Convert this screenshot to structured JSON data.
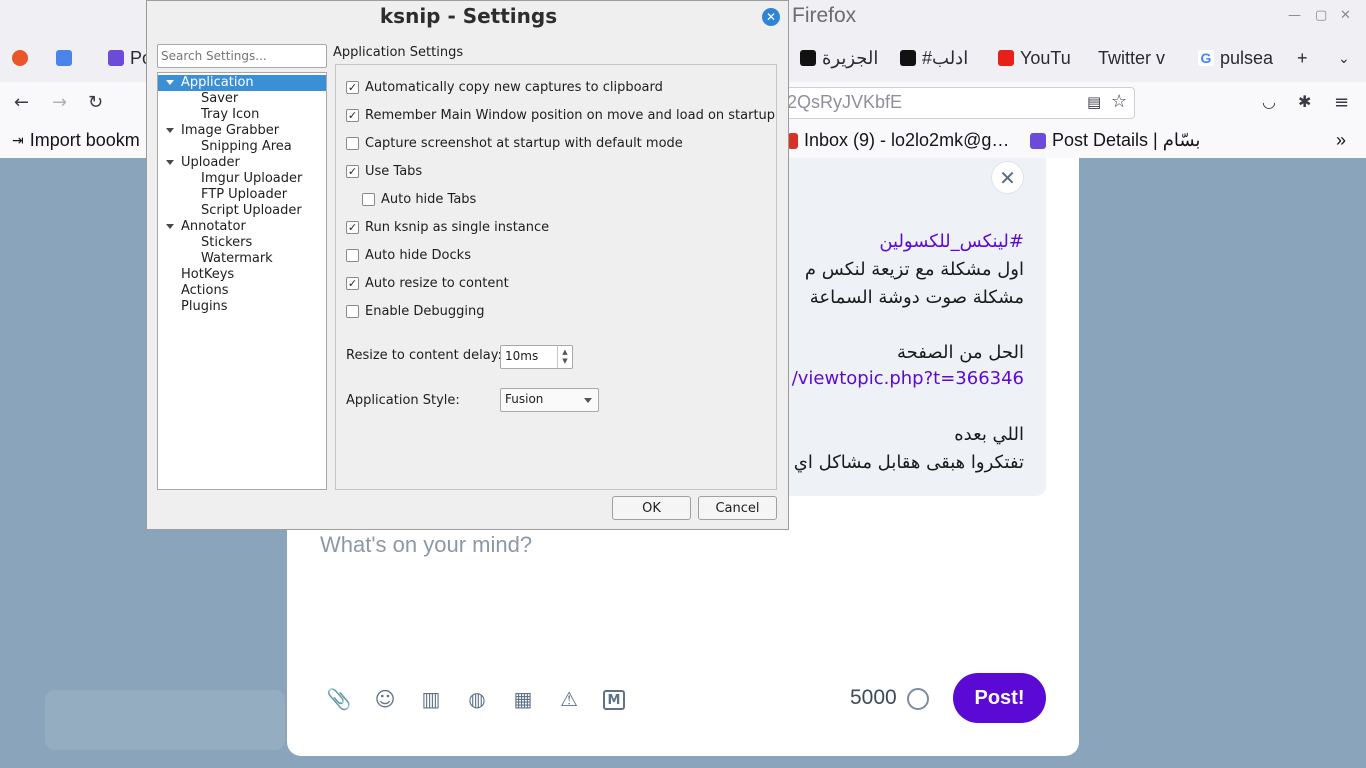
{
  "firefox": {
    "window_title": "Firefox",
    "tabs": [
      "Po",
      "الجزيرة",
      "#ادلب",
      "YouTu",
      "Twitter v",
      "pulsea"
    ],
    "new_tab": "+",
    "url": "2QsRyJVKbfE",
    "bookmarks": [
      "Import bookm",
      "Inbox (9) - lo2lo2mk@g…",
      "Post Details | بسّام"
    ],
    "icons": [
      "back-arrow",
      "forward-arrow",
      "reload",
      "reader-view",
      "star",
      "pocket",
      "extensions",
      "menu"
    ]
  },
  "page": {
    "quoted_lines": [
      "#لينكس_للكسولين",
      "اول مشكلة مع تزيعة لنكس م",
      "مشكلة صوت دوشة السماعة",
      "الحل من الصفحة",
      "/viewtopic.php?t=366346",
      "اللي بعده",
      "تفتكروا هبقى هقابل مشاكل اي"
    ],
    "compose_placeholder": "What's on your mind?",
    "char_count": "5000",
    "post_button": "Post!",
    "toolbar_icons": [
      "attach-icon",
      "emoji-icon",
      "poll-icon",
      "globe-icon",
      "schedule-icon",
      "warning-icon",
      "markdown-icon"
    ]
  },
  "dialog": {
    "title": "ksnip - Settings",
    "search_placeholder": "Search Settings...",
    "tree": [
      {
        "label": "Application",
        "level": 0,
        "expanded": true,
        "selected": true
      },
      {
        "label": "Saver",
        "level": 1
      },
      {
        "label": "Tray Icon",
        "level": 1
      },
      {
        "label": "Image Grabber",
        "level": 0,
        "expanded": true
      },
      {
        "label": "Snipping Area",
        "level": 1
      },
      {
        "label": "Uploader",
        "level": 0,
        "expanded": true
      },
      {
        "label": "Imgur Uploader",
        "level": 1
      },
      {
        "label": "FTP Uploader",
        "level": 1
      },
      {
        "label": "Script Uploader",
        "level": 1
      },
      {
        "label": "Annotator",
        "level": 0,
        "expanded": true
      },
      {
        "label": "Stickers",
        "level": 1
      },
      {
        "label": "Watermark",
        "level": 1
      },
      {
        "label": "HotKeys",
        "level": 0
      },
      {
        "label": "Actions",
        "level": 0
      },
      {
        "label": "Plugins",
        "level": 0
      }
    ],
    "panel_title": "Application Settings",
    "options": [
      {
        "label": "Automatically copy new captures to clipboard",
        "checked": true
      },
      {
        "label": "Remember Main Window position on move and load on startup",
        "checked": true
      },
      {
        "label": "Capture screenshot at startup with default mode",
        "checked": false
      },
      {
        "label": "Use Tabs",
        "checked": true
      },
      {
        "label": "Auto hide Tabs",
        "checked": false,
        "indent": true
      },
      {
        "label": "Run ksnip as single instance",
        "checked": true
      },
      {
        "label": "Auto hide Docks",
        "checked": false
      },
      {
        "label": "Auto resize to content",
        "checked": true
      },
      {
        "label": "Enable Debugging",
        "checked": false
      }
    ],
    "resize_delay_label": "Resize to content delay:",
    "resize_delay_value": "10ms",
    "app_style_label": "Application Style:",
    "app_style_value": "Fusion",
    "ok_label": "OK",
    "cancel_label": "Cancel"
  }
}
